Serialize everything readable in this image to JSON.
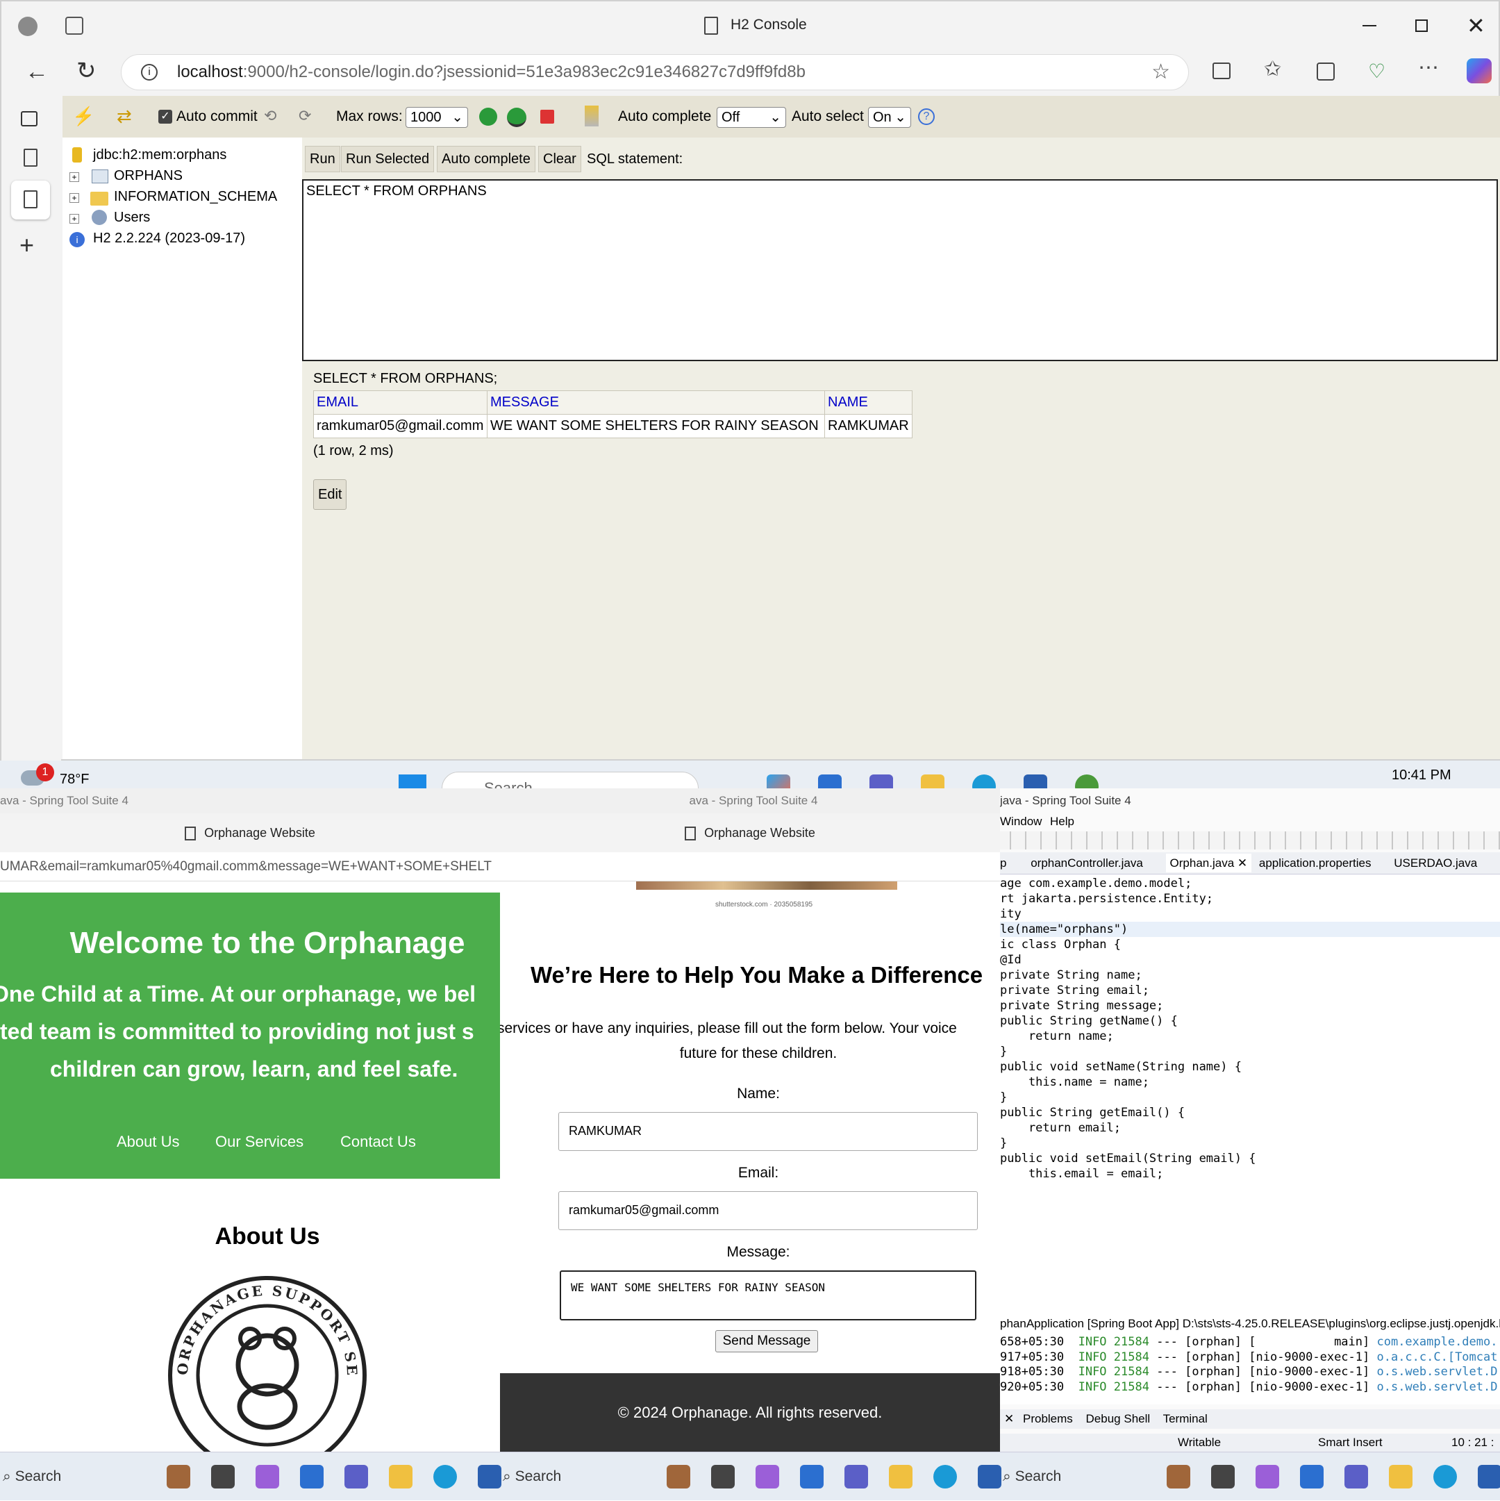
{
  "browser": {
    "tab_title": "H2 Console",
    "url_host": "localhost",
    "url_rest": ":9000/h2-console/login.do?jsessionid=51e3a983ec2c91e346827c7d9ff9fd8b"
  },
  "h2": {
    "toolbar": {
      "auto_commit": "Auto commit",
      "max_rows_label": "Max rows:",
      "max_rows_value": "1000",
      "auto_complete_label": "Auto complete",
      "auto_complete_value": "Off",
      "auto_select_label": "Auto select",
      "auto_select_value": "On"
    },
    "tree": {
      "connection": "jdbc:h2:mem:orphans",
      "items": [
        "ORPHANS",
        "INFORMATION_SCHEMA",
        "Users"
      ],
      "version": "H2 2.2.224 (2023-09-17)"
    },
    "buttons": {
      "run": "Run",
      "run_selected": "Run Selected",
      "auto_complete": "Auto complete",
      "clear": "Clear",
      "sql_statement": "SQL statement:"
    },
    "editor_text": "SELECT * FROM ORPHANS",
    "result": {
      "query": "SELECT * FROM ORPHANS;",
      "columns": [
        "EMAIL",
        "MESSAGE",
        "NAME"
      ],
      "rows": [
        [
          "ramkumar05@gmail.comm",
          "WE WANT SOME SHELTERS FOR RAINY SEASON",
          "RAMKUMAR"
        ]
      ],
      "summary": "(1 row, 2 ms)",
      "edit": "Edit"
    }
  },
  "midbar": {
    "weather": "78°F",
    "weather_badge": "1",
    "search": "Search",
    "time": "10:41 PM"
  },
  "left_pane": {
    "window_title": "ava - Spring Tool Suite 4",
    "tab_title": "Orphanage Website",
    "url": "UMAR&email=ramkumar05%40gmail.comm&message=WE+WANT+SOME+SHELT",
    "hero_title": "Welcome to the Orphanage",
    "hero_line1": "One Child at a Time. At our orphanage, we bel",
    "hero_line2": "ted team is committed to providing not just s",
    "hero_line3": "children can grow, learn, and feel safe.",
    "nav": [
      "About Us",
      "Our Services",
      "Contact Us"
    ],
    "about_heading": "About Us",
    "logo_text": "ORPHANAGE SUPPORT SERVICES ORGANIZATION"
  },
  "mid_pane": {
    "window_title": "ava - Spring Tool Suite 4",
    "tab_title": "Orphanage Website",
    "image_credit": "shutterstock.com · 2035058195",
    "heading": "We’re Here to Help You Make a Difference",
    "intro_line1": "services or have any inquiries, please fill out the form below. Your voice",
    "intro_line2": "future for these children.",
    "name_label": "Name:",
    "name_value": "RAMKUMAR",
    "email_label": "Email:",
    "email_value": "ramkumar05@gmail.comm",
    "message_label": "Message:",
    "message_value": "WE WANT SOME SHELTERS FOR RAINY SEASON",
    "send": "Send Message",
    "footer": "© 2024 Orphanage. All rights reserved."
  },
  "eclipse": {
    "window_title": "java - Spring Tool Suite 4",
    "menu": [
      "Window",
      "Help"
    ],
    "tabs": [
      "p",
      "orphanController.java",
      "Orphan.java",
      "application.properties",
      "USERDAO.java"
    ],
    "code": [
      {
        "t": "age com.example.demo.model;"
      },
      {
        "t": ""
      },
      {
        "t": "rt jakarta.persistence.Entity;"
      },
      {
        "t": ""
      },
      {
        "t": ""
      },
      {
        "t": ""
      },
      {
        "t": "ity"
      },
      {
        "t": "le(name=\"orphans\")"
      },
      {
        "t": "ic class Orphan {"
      },
      {
        "t": ""
      },
      {
        "t": "@Id"
      },
      {
        "t": "private String name;"
      },
      {
        "t": "private String email;"
      },
      {
        "t": "private String message;"
      },
      {
        "t": ""
      },
      {
        "t": "public String getName() {"
      },
      {
        "t": "    return name;"
      },
      {
        "t": "}"
      },
      {
        "t": "public void setName(String name) {"
      },
      {
        "t": "    this.name = name;"
      },
      {
        "t": "}"
      },
      {
        "t": "public String getEmail() {"
      },
      {
        "t": "    return email;"
      },
      {
        "t": "}"
      },
      {
        "t": "public void setEmail(String email) {"
      },
      {
        "t": "    this.email = email;"
      }
    ],
    "bottom_tabs": [
      "Problems",
      "Debug Shell",
      "Terminal"
    ],
    "console_header": "phanApplication [Spring Boot App] D:\\sts\\sts-4.25.0.RELEASE\\plugins\\org.eclipse.justj.openjdk.h",
    "log": [
      {
        "time": "658+05:30",
        "level": "INFO",
        "pid": "21584",
        "rest": "--- [orphan] [           main]",
        "cls": "com.example.demo."
      },
      {
        "time": "917+05:30",
        "level": "INFO",
        "pid": "21584",
        "rest": "--- [orphan] [nio-9000-exec-1]",
        "cls": "o.a.c.c.C.[Tomcat"
      },
      {
        "time": "918+05:30",
        "level": "INFO",
        "pid": "21584",
        "rest": "--- [orphan] [nio-9000-exec-1]",
        "cls": "o.s.web.servlet.D"
      },
      {
        "time": "920+05:30",
        "level": "INFO",
        "pid": "21584",
        "rest": "--- [orphan] [nio-9000-exec-1]",
        "cls": "o.s.web.servlet.D"
      }
    ],
    "status": {
      "writable": "Writable",
      "insert": "Smart Insert",
      "pos": "10 : 21 :"
    }
  },
  "taskbar": {
    "search": "Search"
  }
}
